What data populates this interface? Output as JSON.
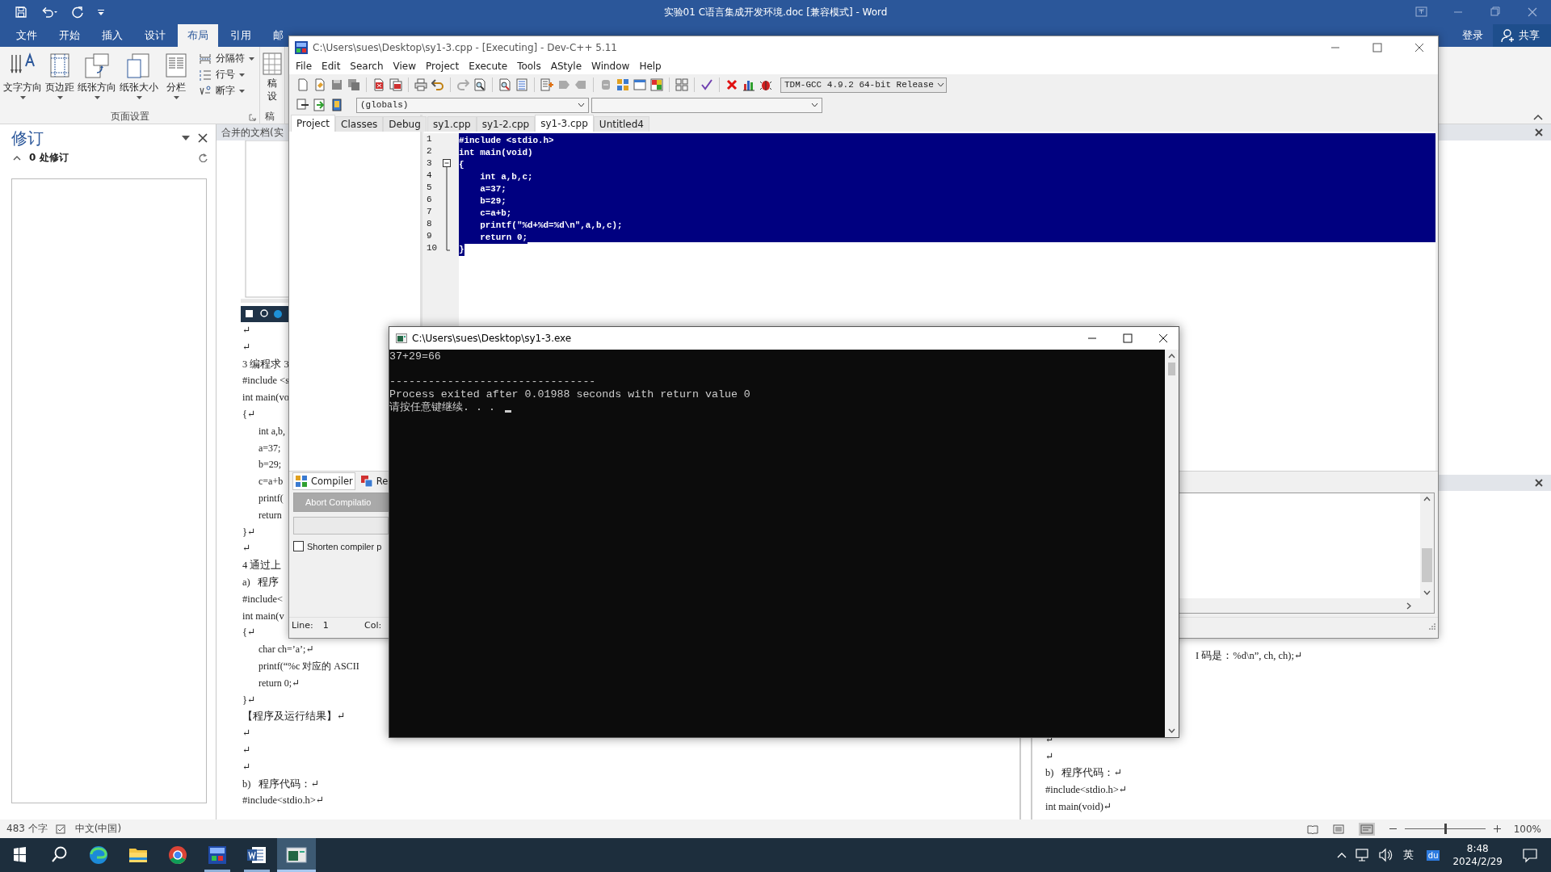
{
  "word": {
    "title": "实验01 C语言集成开发环境.doc [兼容模式] - Word",
    "tabs": [
      {
        "label": "文件",
        "selected": false
      },
      {
        "label": "开始",
        "selected": false
      },
      {
        "label": "插入",
        "selected": false
      },
      {
        "label": "设计",
        "selected": false
      },
      {
        "label": "布局",
        "selected": true
      },
      {
        "label": "引用",
        "selected": false
      },
      {
        "label": "邮",
        "selected": false
      }
    ],
    "sign_in": "登录",
    "share": "共享",
    "ribbon": {
      "large_buttons": [
        "文字方向",
        "页边距",
        "纸张方向",
        "纸张大小",
        "分栏"
      ],
      "small_buttons": [
        "分隔符",
        "行号",
        "断字"
      ],
      "group_label": "页面设置",
      "cut_button": [
        "稿",
        "设"
      ],
      "cut_group_label": "稿"
    },
    "revisions": {
      "title": "修订",
      "summary": "0 处修订"
    },
    "merged_doc": {
      "header": "合并的文档(实",
      "lines": [
        {
          "text": "↵"
        },
        {
          "text": "↵"
        },
        {
          "text": "3 编程求 3"
        },
        {
          "text": "#include <s"
        },
        {
          "text": "int main(vo"
        },
        {
          "text": "{↵",
          "children": [
            {
              "text": "int a,b,"
            },
            {
              "text": "a=37;"
            },
            {
              "text": "b=29;"
            },
            {
              "text": "c=a+b"
            },
            {
              "text": "printf("
            },
            {
              "text": "return"
            }
          ]
        },
        {
          "text": "}↵"
        },
        {
          "text": "↵"
        },
        {
          "text": "4 通过上"
        },
        {
          "text": "a)   程序"
        },
        {
          "text": "#include<"
        },
        {
          "text": "int main(v"
        },
        {
          "text": "{↵",
          "children": [
            {
              "text": "char ch=’a’;↵"
            },
            {
              "text": "printf(“%c 对应的 ASCII"
            },
            {
              "text": "return 0;↵"
            }
          ]
        },
        {
          "text": "}↵"
        },
        {
          "text": "【程序及运行结果】↵"
        },
        {
          "text": "↵"
        },
        {
          "text": "↵"
        },
        {
          "text": "↵"
        },
        {
          "text": "b)   程序代码：↵"
        },
        {
          "text": "#include<stdio.h>↵"
        }
      ]
    },
    "compare_doc": {
      "tail": "I 码是：%d\\n”, ch, ch);↵",
      "lines": [
        "↵",
        "↵",
        "b)   程序代码：↵",
        "#include<stdio.h>↵",
        "int main(void)↵"
      ]
    },
    "status_bar": {
      "word_count": "483 个字",
      "language": "中文(中国)",
      "zoom": "100%",
      "zoom_slider": {
        "level": 0.5
      }
    }
  },
  "devcpp": {
    "title": "C:\\Users\\sues\\Desktop\\sy1-3.cpp - [Executing] - Dev-C++ 5.11",
    "menu": [
      "File",
      "Edit",
      "Search",
      "View",
      "Project",
      "Execute",
      "Tools",
      "AStyle",
      "Window",
      "Help"
    ],
    "compiler": "TDM-GCC 4.9.2 64-bit Release",
    "scope": "(globals)",
    "panel_tabs": [
      {
        "label": "Project",
        "selected": true
      },
      {
        "label": "Classes",
        "selected": false
      },
      {
        "label": "Debug",
        "selected": false
      }
    ],
    "file_tabs": [
      {
        "label": "sy1.cpp",
        "selected": false
      },
      {
        "label": "sy1-2.cpp",
        "selected": false
      },
      {
        "label": "sy1-3.cpp",
        "selected": true
      },
      {
        "label": "Untitled4",
        "selected": false
      }
    ],
    "code": [
      {
        "number": "1",
        "text": "#include <stdio.h>",
        "selected": true
      },
      {
        "number": "2",
        "text": "int main(void)",
        "selected": true
      },
      {
        "number": "3",
        "text": "{",
        "selected": true,
        "collapsed": false
      },
      {
        "number": "4",
        "text": "    int a,b,c;",
        "selected": true
      },
      {
        "number": "5",
        "text": "    a=37;",
        "selected": true
      },
      {
        "number": "6",
        "text": "    b=29;",
        "selected": true
      },
      {
        "number": "7",
        "text": "    c=a+b;",
        "selected": true
      },
      {
        "number": "8",
        "text": "    printf(\"%d+%d=%d\\n\",a,b,c);",
        "selected": true
      },
      {
        "number": "9",
        "text": "    return 0;",
        "selected": true
      },
      {
        "number": "10",
        "text": "}",
        "selected": true
      }
    ],
    "bottom_tabs": [
      {
        "label": "Compiler",
        "selected": true
      },
      {
        "label": "Re",
        "selected": false
      }
    ],
    "abort_button": {
      "label": "Abort Compilatio",
      "disabled": true
    },
    "shorten_option": {
      "label": "Shorten compiler p",
      "checked": false
    },
    "status": {
      "line_label": "Line:",
      "line": "1",
      "col_label": "Col:"
    }
  },
  "console": {
    "title": "C:\\Users\\sues\\Desktop\\sy1-3.exe",
    "lines": [
      {
        "kind": "text",
        "text": "37+29=66"
      },
      {
        "kind": "blank"
      },
      {
        "kind": "text",
        "text": "--------------------------------"
      },
      {
        "kind": "text",
        "text": "Process exited after 0.01988 seconds with return value 0"
      },
      {
        "kind": "text",
        "text": "请按任意键继续. . ."
      }
    ],
    "cursor": true
  },
  "taskbar": {
    "ime": "英",
    "tray_badge": "du",
    "time": "8:48",
    "date": "2024/2/29"
  }
}
